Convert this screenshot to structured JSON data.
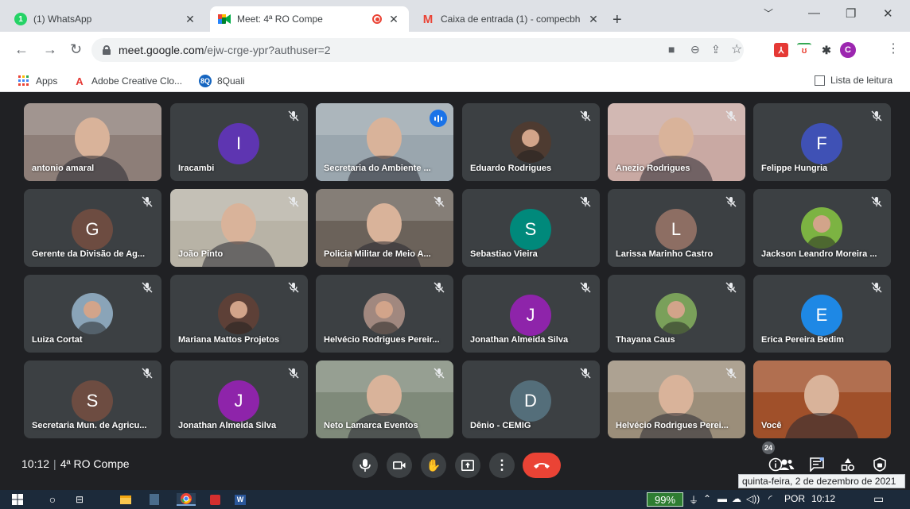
{
  "browser": {
    "tabs": [
      {
        "title": "(1) WhatsApp",
        "favicon": "whatsapp-icon",
        "color": "#25d366"
      },
      {
        "title": "Meet: 4ª RO Compe",
        "favicon": "meet-icon",
        "color": "#00832d"
      },
      {
        "title": "Caixa de entrada (1) - compecbh",
        "favicon": "gmail-icon",
        "color": "#ea4335"
      }
    ],
    "url_host": "meet.google.com",
    "url_path": "/ejw-crge-ypr?authuser=2",
    "profile_initial": "C",
    "bookmarks": [
      "Apps",
      "Adobe Creative Clo...",
      "8Quali"
    ],
    "reading_list": "Lista de leitura"
  },
  "participants": [
    {
      "name": "antonio amaral",
      "type": "video",
      "bg": "#8d7e78",
      "muted": false
    },
    {
      "name": "Iracambi",
      "type": "avatar",
      "initial": "I",
      "color": "#5e35b1",
      "muted": true
    },
    {
      "name": "Secretaria do Ambiente ...",
      "type": "video",
      "bg": "#9aa6ae",
      "muted": false,
      "speaking": true
    },
    {
      "name": "Eduardo Rodrigues",
      "type": "photo",
      "bg": "#4e3b31",
      "muted": true
    },
    {
      "name": "Anezio Rodrigues",
      "type": "video",
      "bg": "#c9a9a3",
      "muted": true
    },
    {
      "name": "Felippe Hungria",
      "type": "avatar",
      "initial": "F",
      "color": "#3f51b5",
      "muted": true
    },
    {
      "name": "Gerente da Divisão de Ag...",
      "type": "avatar",
      "initial": "G",
      "color": "#6d4c41",
      "muted": true
    },
    {
      "name": "João Pinto",
      "type": "video",
      "bg": "#b8b3a6",
      "muted": true
    },
    {
      "name": "Policia Militar de Meio A...",
      "type": "video",
      "bg": "#6b625a",
      "muted": true
    },
    {
      "name": "Sebastiao Vieira",
      "type": "avatar",
      "initial": "S",
      "color": "#00897b",
      "muted": true
    },
    {
      "name": "Larissa Marinho Castro",
      "type": "avatar",
      "initial": "L",
      "color": "#8d6e63",
      "muted": true
    },
    {
      "name": "Jackson Leandro Moreira ...",
      "type": "photo",
      "bg": "#7cb342",
      "muted": true
    },
    {
      "name": "Luiza Cortat",
      "type": "photo",
      "bg": "#8aa4b8",
      "muted": true
    },
    {
      "name": "Mariana Mattos Projetos",
      "type": "photo",
      "bg": "#5d4037",
      "muted": true
    },
    {
      "name": "Helvécio Rodrigues Pereir...",
      "type": "photo",
      "bg": "#a1887f",
      "muted": true
    },
    {
      "name": "Jonathan Almeida Silva",
      "type": "avatar",
      "initial": "J",
      "color": "#8e24aa",
      "muted": true
    },
    {
      "name": "Thayana Caus",
      "type": "photo",
      "bg": "#7aa05a",
      "muted": true
    },
    {
      "name": "Erica Pereira Bedim",
      "type": "avatar",
      "initial": "E",
      "color": "#1e88e5",
      "muted": true
    },
    {
      "name": "Secretaria Mun. de Agricu...",
      "type": "avatar",
      "initial": "S",
      "color": "#6d4c41",
      "muted": true
    },
    {
      "name": "Jonathan Almeida Silva",
      "type": "avatar",
      "initial": "J",
      "color": "#8e24aa",
      "muted": true
    },
    {
      "name": "Neto Lamarca Eventos",
      "type": "video",
      "bg": "#7f8a7a",
      "muted": true
    },
    {
      "name": "Dênio - CEMIG",
      "type": "avatar",
      "initial": "D",
      "color": "#546e7a",
      "muted": true
    },
    {
      "name": "Helvécio Rodrigues Perei...",
      "type": "video",
      "bg": "#9b8e7a",
      "muted": true
    },
    {
      "name": "Você",
      "type": "video",
      "bg": "#a0502a",
      "muted": false
    }
  ],
  "meeting": {
    "time": "10:12",
    "title": "4ª RO Compe",
    "participant_count": "24"
  },
  "tooltip": "quinta-feira, 2 de dezembro de 2021",
  "taskbar": {
    "battery": "99%",
    "language": "POR",
    "clock": "10:12"
  }
}
